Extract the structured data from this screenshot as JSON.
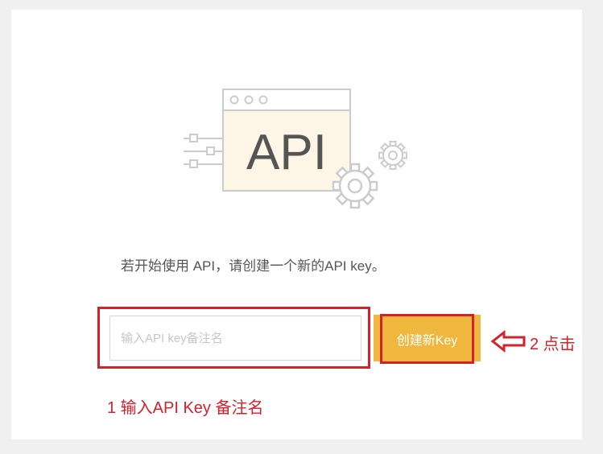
{
  "illustration": {
    "icon": "api-window-icon",
    "label": "API"
  },
  "intro_text": "若开始使用 API，请创建一个新的API key。",
  "api_key_form": {
    "remark_input_placeholder": "输入API key备注名",
    "remark_input_value": "",
    "create_button_label": "创建新Key"
  },
  "annotations": {
    "step1": "1 输入API Key 备注名",
    "step2": "2 点击",
    "arrow_icon": "left-arrow-icon"
  },
  "colors": {
    "accent_button": "#efb73e",
    "annotation_red": "#d6202a",
    "illustration_fill": "#fdf6e7",
    "illustration_stroke": "#cccccc"
  }
}
